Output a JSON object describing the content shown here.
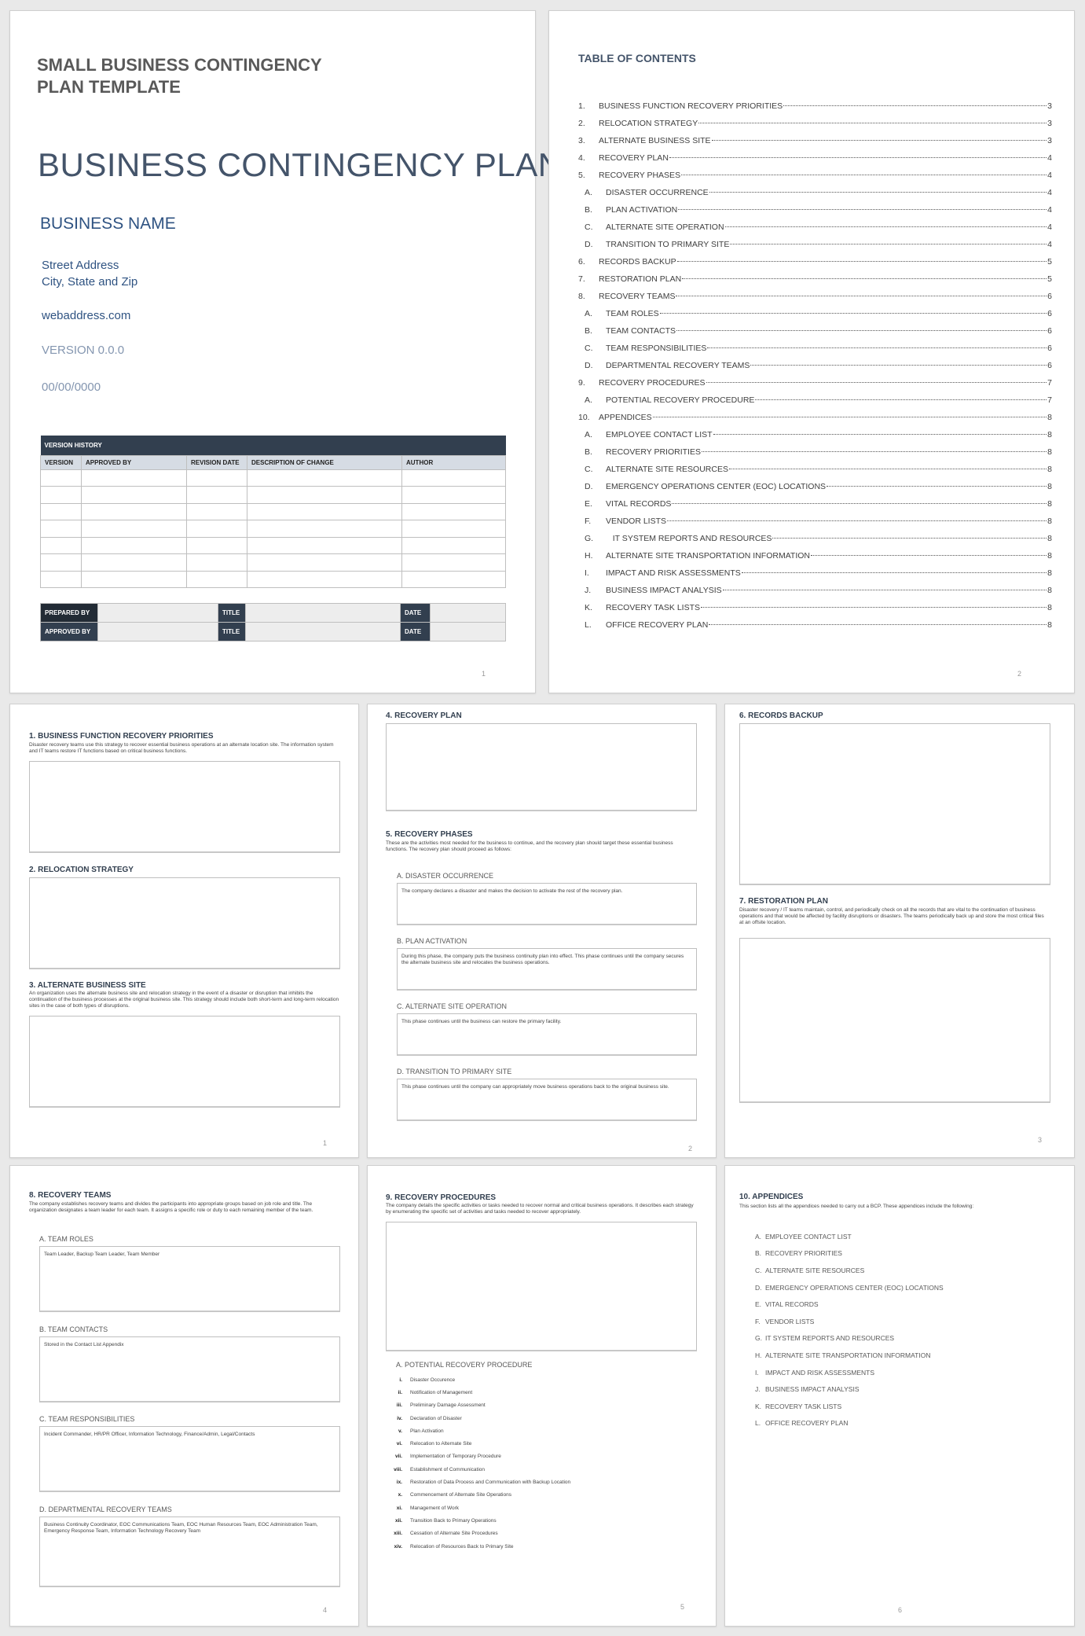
{
  "cover": {
    "template_title": "SMALL BUSINESS CONTINGENCY PLAN TEMPLATE",
    "doc_title": "BUSINESS CONTINGENCY PLAN",
    "business_name": "BUSINESS NAME",
    "street": "Street Address",
    "city": "City, State and Zip",
    "web": "webaddress.com",
    "version": "VERSION 0.0.0",
    "date": "00/00/0000",
    "version_history": {
      "title": "VERSION HISTORY",
      "columns": [
        "VERSION",
        "APPROVED BY",
        "REVISION DATE",
        "DESCRIPTION OF CHANGE",
        "AUTHOR"
      ],
      "empty_rows": 7
    },
    "signoff": {
      "prepared_by": "PREPARED BY",
      "approved_by": "APPROVED BY",
      "title": "TITLE",
      "date": "DATE"
    },
    "page_number": "1"
  },
  "toc": {
    "title": "TABLE OF CONTENTS",
    "page_number": "2",
    "entries": [
      {
        "num": "1.",
        "text": "BUSINESS FUNCTION RECOVERY PRIORITIES",
        "page": "3",
        "sub": false
      },
      {
        "num": "2.",
        "text": "RELOCATION STRATEGY",
        "page": "3",
        "sub": false
      },
      {
        "num": "3.",
        "text": "ALTERNATE BUSINESS SITE",
        "page": "3",
        "sub": false
      },
      {
        "num": "4.",
        "text": "RECOVERY PLAN",
        "page": "4",
        "sub": false
      },
      {
        "num": "5.",
        "text": "RECOVERY PHASES",
        "page": "4",
        "sub": false
      },
      {
        "num": "A.",
        "text": "DISASTER OCCURRENCE",
        "page": "4",
        "sub": true
      },
      {
        "num": "B.",
        "text": "PLAN ACTIVATION",
        "page": "4",
        "sub": true
      },
      {
        "num": "C.",
        "text": "ALTERNATE SITE OPERATION",
        "page": "4",
        "sub": true
      },
      {
        "num": "D.",
        "text": "TRANSITION TO PRIMARY SITE",
        "page": "4",
        "sub": true
      },
      {
        "num": "6.",
        "text": "RECORDS BACKUP",
        "page": "5",
        "sub": false
      },
      {
        "num": "7.",
        "text": "RESTORATION PLAN",
        "page": "5",
        "sub": false
      },
      {
        "num": "8.",
        "text": "RECOVERY TEAMS",
        "page": "6",
        "sub": false
      },
      {
        "num": "A.",
        "text": "TEAM ROLES",
        "page": "6",
        "sub": true
      },
      {
        "num": "B.",
        "text": "TEAM CONTACTS",
        "page": "6",
        "sub": true
      },
      {
        "num": "C.",
        "text": "TEAM RESPONSIBILITIES",
        "page": "6",
        "sub": true
      },
      {
        "num": "D.",
        "text": "DEPARTMENTAL RECOVERY TEAMS",
        "page": "6",
        "sub": true
      },
      {
        "num": "9.",
        "text": "RECOVERY PROCEDURES",
        "page": "7",
        "sub": false
      },
      {
        "num": "A.",
        "text": "POTENTIAL RECOVERY PROCEDURE",
        "page": "7",
        "sub": true
      },
      {
        "num": "10.",
        "text": "APPENDICES",
        "page": "8",
        "sub": false
      },
      {
        "num": "A.",
        "text": "EMPLOYEE CONTACT LIST",
        "page": "8",
        "sub": true
      },
      {
        "num": "B.",
        "text": "RECOVERY PRIORITIES",
        "page": "8",
        "sub": true
      },
      {
        "num": "C.",
        "text": "ALTERNATE SITE RESOURCES",
        "page": "8",
        "sub": true
      },
      {
        "num": "D.",
        "text": "EMERGENCY OPERATIONS CENTER (EOC) LOCATIONS",
        "page": "8",
        "sub": true
      },
      {
        "num": "E.",
        "text": "VITAL RECORDS",
        "page": "8",
        "sub": true
      },
      {
        "num": "F.",
        "text": "VENDOR LISTS",
        "page": "8",
        "sub": true
      },
      {
        "num": "G.",
        "text": "   IT SYSTEM REPORTS AND RESOURCES",
        "page": "8",
        "sub": true
      },
      {
        "num": "H.",
        "text": "ALTERNATE SITE TRANSPORTATION INFORMATION",
        "page": "8",
        "sub": true
      },
      {
        "num": "I.",
        "text": "IMPACT AND RISK ASSESSMENTS",
        "page": "8",
        "sub": true
      },
      {
        "num": "J.",
        "text": "BUSINESS IMPACT ANALYSIS",
        "page": "8",
        "sub": true
      },
      {
        "num": "K.",
        "text": "RECOVERY TASK LISTS",
        "page": "8",
        "sub": true
      },
      {
        "num": "L.",
        "text": "OFFICE RECOVERY PLAN",
        "page": "8",
        "sub": true
      }
    ]
  },
  "page3": {
    "page_number": "1",
    "s1": {
      "heading": "1.  BUSINESS FUNCTION RECOVERY PRIORITIES",
      "desc": "Disaster recovery teams use this strategy to recover essential business operations at an alternate location site. The information system and IT teams restore IT functions based on critical business functions."
    },
    "s2": {
      "heading": "2.  RELOCATION STRATEGY"
    },
    "s3": {
      "heading": "3.  ALTERNATE BUSINESS SITE",
      "desc": "An organization uses the alternate business site and relocation strategy in the event of a disaster or disruption that inhibits the continuation of the business processes at the original business site. This strategy should include both short-term and long-term relocation sites in the case of both types of disruptions."
    }
  },
  "page4": {
    "page_number": "2",
    "s4": {
      "heading": "4.  RECOVERY PLAN"
    },
    "s5": {
      "heading": "5.  RECOVERY PHASES",
      "desc": "These are the activities most needed for the business to continue, and the recovery plan should target these essential business functions. The recovery plan should proceed as follows:"
    },
    "phases": [
      {
        "label": "A.  DISASTER OCCURRENCE",
        "text": "The company declares a disaster and makes the decision to activate the rest of the recovery plan."
      },
      {
        "label": "B.  PLAN ACTIVATION",
        "text": "During this phase, the company puts the business continuity plan into effect. This phase continues until the company secures the alternate business site and relocates the business operations."
      },
      {
        "label": "C.  ALTERNATE SITE OPERATION",
        "text": "This phase continues until the business can restore the primary facility."
      },
      {
        "label": "D.  TRANSITION TO PRIMARY SITE",
        "text": "This phase continues until the company can appropriately move business operations back to the original business site."
      }
    ]
  },
  "page5": {
    "page_number": "3",
    "s6": {
      "heading": "6.  RECORDS BACKUP"
    },
    "s7": {
      "heading": "7.  RESTORATION PLAN",
      "desc": "Disaster recovery / IT teams maintain, control, and periodically check on all the records that are vital to the continuation of business operations and that would be affected by facility disruptions or disasters. The teams periodically back up and store the most critical files at an offsite location."
    }
  },
  "page6": {
    "page_number": "4",
    "s8": {
      "heading": "8.  RECOVERY TEAMS",
      "desc": "The company establishes recovery teams and divides the participants into appropriate groups based on job role and title. The organization designates a team leader for each team. It assigns a specific role or duty to each remaining member of the team."
    },
    "subs": [
      {
        "label": "A.  TEAM ROLES",
        "text": "Team Leader, Backup Team Leader, Team Member"
      },
      {
        "label": "B.  TEAM CONTACTS",
        "text": "Stored in the Contact List Appendix"
      },
      {
        "label": "C.  TEAM RESPONSIBILITIES",
        "text": "Incident Commander, HR/PR Officer, Information Technology, Finance/Admin, Legal/Contacts"
      },
      {
        "label": "D.  DEPARTMENTAL RECOVERY TEAMS",
        "text": "Business Continuity Coordinator, EOC Communications Team, EOC Human Resources Team, EOC Administration Team, Emergency Response Team, Information Technology Recovery Team"
      }
    ]
  },
  "page7": {
    "page_number": "5",
    "s9": {
      "heading": "9.  RECOVERY PROCEDURES",
      "desc": "The company details the specific activities or tasks needed to recover normal and critical business operations. It describes each strategy by enumerating the specific set of activities and tasks needed to recover appropriately."
    },
    "sub_label": "A.  POTENTIAL RECOVERY PROCEDURE",
    "steps": [
      {
        "num": "i.",
        "text": "Disaster Occurence"
      },
      {
        "num": "ii.",
        "text": "Notification of Management"
      },
      {
        "num": "iii.",
        "text": "Preliminary Damage Assessment"
      },
      {
        "num": "iv.",
        "text": "Declaration of Disaster"
      },
      {
        "num": "v.",
        "text": "Plan Activation"
      },
      {
        "num": "vi.",
        "text": "Relocation to Alternate Site"
      },
      {
        "num": "vii.",
        "text": "Implementation of Temporary Procedure"
      },
      {
        "num": "viii.",
        "text": "Establishment of Communication"
      },
      {
        "num": "ix.",
        "text": "Restoration of Data Process and Communication with Backup Location"
      },
      {
        "num": "x.",
        "text": "Commencement of Alternate Site Operations"
      },
      {
        "num": "xi.",
        "text": "Management of Work"
      },
      {
        "num": "xii.",
        "text": "Transition Back to Primary Operations"
      },
      {
        "num": "xiii.",
        "text": "Cessation of Alternate Site Procedures"
      },
      {
        "num": "xiv.",
        "text": "Relocation of Resources Back to Primary Site"
      }
    ]
  },
  "page8": {
    "page_number": "6",
    "s10": {
      "heading": "10.    APPENDICES",
      "desc": "This section lists all the appendices needed to carry out a BCP. These appendices include the following:"
    },
    "items": [
      {
        "l": "A.",
        "t": "EMPLOYEE CONTACT LIST"
      },
      {
        "l": "B.",
        "t": "RECOVERY PRIORITIES"
      },
      {
        "l": "C.",
        "t": "ALTERNATE SITE RESOURCES"
      },
      {
        "l": "D.",
        "t": "EMERGENCY OPERATIONS CENTER (EOC) LOCATIONS"
      },
      {
        "l": "E.",
        "t": "VITAL RECORDS"
      },
      {
        "l": "F.",
        "t": "VENDOR LISTS"
      },
      {
        "l": "G.",
        "t": "IT SYSTEM REPORTS AND RESOURCES"
      },
      {
        "l": "H.",
        "t": "ALTERNATE SITE TRANSPORTATION INFORMATION"
      },
      {
        "l": "I.",
        "t": "IMPACT AND RISK ASSESSMENTS"
      },
      {
        "l": "J.",
        "t": "BUSINESS IMPACT ANALYSIS"
      },
      {
        "l": "K.",
        "t": "RECOVERY TASK LISTS"
      },
      {
        "l": "L.",
        "t": "OFFICE RECOVERY PLAN"
      }
    ]
  }
}
